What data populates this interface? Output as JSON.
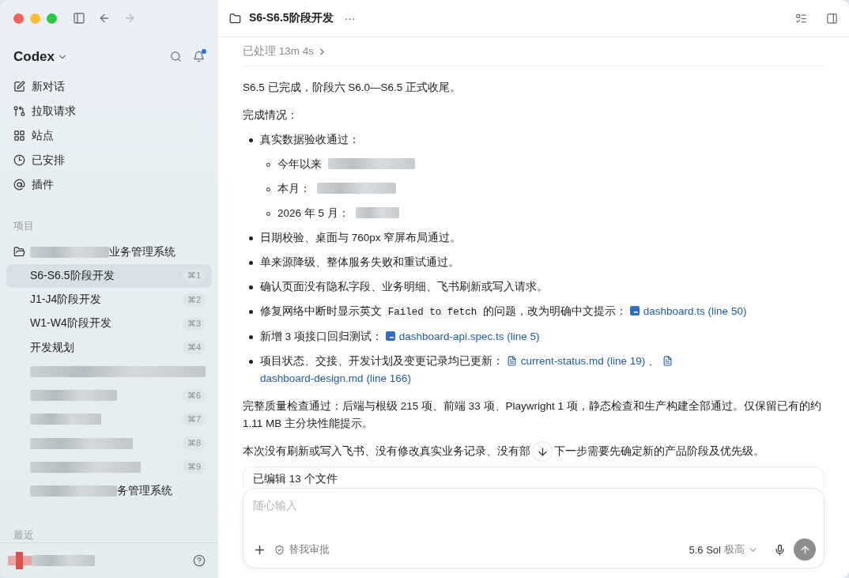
{
  "sidebar": {
    "app_name": "Codex",
    "has_notification": true,
    "nav": [
      {
        "label": "新对话"
      },
      {
        "label": "拉取请求"
      },
      {
        "label": "站点"
      },
      {
        "label": "已安排"
      },
      {
        "label": "插件"
      }
    ],
    "projects_heading": "项目",
    "project": {
      "redacted": true,
      "tail": "业务管理系统"
    },
    "threads": [
      {
        "label": "S6-S6.5阶段开发",
        "shortcut": "⌘1",
        "selected": true,
        "redacted": false
      },
      {
        "label": "J1-J4阶段开发",
        "shortcut": "⌘2",
        "selected": false,
        "redacted": false
      },
      {
        "label": "W1-W4阶段开发",
        "shortcut": "⌘3",
        "selected": false,
        "redacted": false
      },
      {
        "label": "开发规划",
        "shortcut": "⌘4",
        "selected": false,
        "redacted": false
      },
      {
        "selected": false,
        "redacted": true
      },
      {
        "shortcut": "⌘6",
        "selected": false,
        "redacted": true
      },
      {
        "shortcut": "⌘7",
        "selected": false,
        "redacted": true
      },
      {
        "shortcut": "⌘8",
        "selected": false,
        "redacted": true
      },
      {
        "shortcut": "⌘9",
        "selected": false,
        "redacted": true
      },
      {
        "tail": "务管理系统",
        "selected": false,
        "redacted": true
      }
    ],
    "recent_heading": "最近"
  },
  "header": {
    "title": "S6-S6.5阶段开发",
    "more": "···"
  },
  "thread": {
    "processed": "已处理 13m 4s",
    "intro": "S6.5 已完成，阶段六 S6.0—S6.5 正式收尾。",
    "summary_heading": "完成情况：",
    "bullets": [
      {
        "parts": [
          {
            "kind": "text",
            "text": "真实数据验收通过："
          }
        ],
        "children": [
          {
            "text": "今年以来",
            "redacted": true
          },
          {
            "text": "本月：",
            "redacted": true
          },
          {
            "text": "2026 年 5 月：",
            "redacted": true
          }
        ]
      },
      {
        "parts": [
          {
            "kind": "text",
            "text": "日期校验、桌面与 760px 窄屏布局通过。"
          }
        ]
      },
      {
        "parts": [
          {
            "kind": "text",
            "text": "单来源降级、整体服务失败和重试通过。"
          }
        ]
      },
      {
        "parts": [
          {
            "kind": "text",
            "text": "确认页面没有隐私字段、业务明细、飞书刷新或写入请求。"
          }
        ]
      },
      {
        "parts": [
          {
            "kind": "text",
            "text": "修复网络中断时显示英文 "
          },
          {
            "kind": "code",
            "text": "Failed to fetch"
          },
          {
            "kind": "text",
            "text": " 的问题，改为明确中文提示： "
          },
          {
            "kind": "ts-link",
            "text": "dashboard.ts (line 50)"
          }
        ]
      },
      {
        "parts": [
          {
            "kind": "text",
            "text": "新增 3 项接口回归测试： "
          },
          {
            "kind": "ts-link",
            "text": "dashboard-api.spec.ts (line 5)"
          }
        ]
      },
      {
        "parts": [
          {
            "kind": "text",
            "text": "项目状态、交接、开发计划及变更记录均已更新： "
          },
          {
            "kind": "doc-link",
            "text": "current-status.md (line 19)"
          },
          {
            "kind": "text",
            "text": " 、 "
          },
          {
            "kind": "doc-link",
            "text": "dashboard-design.md"
          },
          {
            "kind": "link",
            "text": "(line 166)"
          }
        ]
      }
    ],
    "quality": "完整质量检查通过：后端与根级 215 项、前端 33 项、Playwright 1 项，静态检查和生产构建全部通过。仅保留已有的约 1.11 MB 主分块性能提示。",
    "final_before": "本次没有刷新或写入飞书、没有修改真实业务记录、没有部",
    "final_after": "下一步需要先确定新的产品阶段及优先级。",
    "edited_files": "已编辑 13 个文件"
  },
  "composer": {
    "placeholder": "随心输入",
    "approval": "替我审批",
    "model": "5.6 Sol",
    "effort": "极高"
  }
}
